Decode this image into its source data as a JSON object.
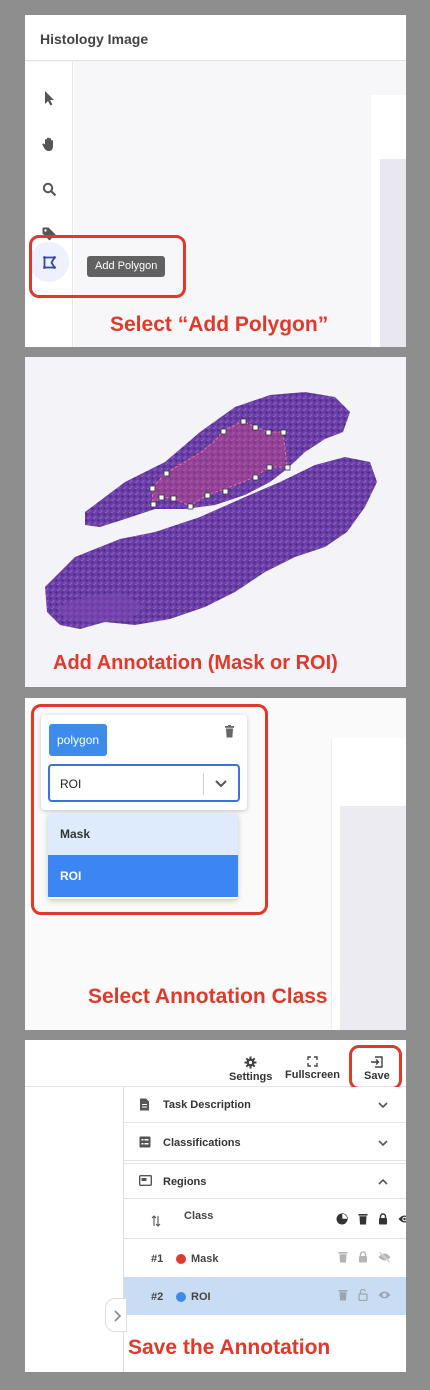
{
  "panel1": {
    "title": "Histology Image",
    "tooltip": "Add Polygon",
    "callout": "Select “Add Polygon”",
    "tools": [
      "cursor-icon",
      "hand-icon",
      "search-icon",
      "tag-icon",
      "polygon-icon"
    ]
  },
  "panel2": {
    "callout": "Add Annotation (Mask or ROI)"
  },
  "panel3": {
    "chip": "polygon",
    "select_value": "ROI",
    "options": [
      "Mask",
      "ROI"
    ],
    "selected_option": "ROI",
    "callout": "Select Annotation Class"
  },
  "panel4": {
    "toolbar": {
      "settings": "Settings",
      "fullscreen": "Fullscreen",
      "save": "Save"
    },
    "sections": {
      "task": "Task Description",
      "classifications": "Classifications",
      "regions": "Regions"
    },
    "class_header": "Class",
    "regions": [
      {
        "num": "#1",
        "label": "Mask",
        "color": "#e03a2f"
      },
      {
        "num": "#2",
        "label": "ROI",
        "color": "#3d8bea"
      }
    ],
    "callout": "Save the Annotation"
  },
  "colors": {
    "accent_red": "#e0392b",
    "tissue": "#6a3aa0",
    "selected_row": "#c8ddf4"
  }
}
